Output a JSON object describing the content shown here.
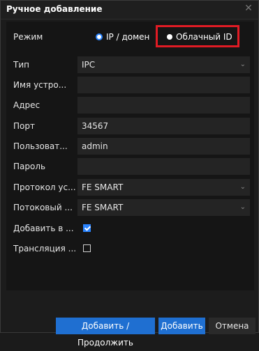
{
  "dialog": {
    "title": "Ручное добавление",
    "close_icon": "close-icon"
  },
  "mode": {
    "label": "Режим",
    "options": [
      {
        "label": "IP / домен",
        "selected": true
      },
      {
        "label": "Облачный ID",
        "selected": false
      }
    ]
  },
  "fields": [
    {
      "label": "Тип",
      "value": "IPC",
      "dropdown": true
    },
    {
      "label": "Имя устро...",
      "value": "",
      "dropdown": false
    },
    {
      "label": "Адрес",
      "value": "",
      "dropdown": false
    },
    {
      "label": "Порт",
      "value": "34567",
      "dropdown": false
    },
    {
      "label": "Пользоват...",
      "value": "admin",
      "dropdown": false
    },
    {
      "label": "Пароль",
      "value": "",
      "dropdown": false
    },
    {
      "label": "Протокол ус...",
      "value": "FE SMART",
      "dropdown": true
    },
    {
      "label": "Потоковый ...",
      "value": "FE SMART",
      "dropdown": true
    }
  ],
  "checks": [
    {
      "label": "Добавить в ...",
      "checked": true
    },
    {
      "label": "Трансляция ...",
      "checked": false
    }
  ],
  "buttons": {
    "add_continue": "Добавить / Продолжить",
    "add": "Добавить",
    "cancel": "Отмена"
  },
  "colors": {
    "accent": "#1f6fd1",
    "highlight": "#e01b24"
  }
}
